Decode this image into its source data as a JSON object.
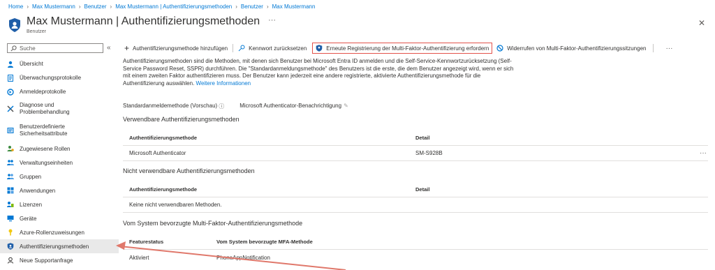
{
  "breadcrumb": [
    "Home",
    "Max Mustermann",
    "Benutzer",
    "Max Mustermann | Authentifizierungsmethoden",
    "Benutzer",
    "Max Mustermann"
  ],
  "header": {
    "title": "Max Mustermann | Authentifizierungsmethoden",
    "subtitle": "Benutzer",
    "more": "···",
    "close": "✕"
  },
  "sidebar": {
    "search_placeholder": "Suche",
    "collapse": "«",
    "items": [
      {
        "label": "Übersicht",
        "icon": "user-icon"
      },
      {
        "label": "Überwachungsprotokolle",
        "icon": "log-icon"
      },
      {
        "label": "Anmeldeprotokolle",
        "icon": "signin-icon"
      },
      {
        "label": "Diagnose und Problembehandlung",
        "icon": "wrench-icon"
      },
      {
        "label": "Benutzerdefinierte Sicherheitsattribute",
        "icon": "attribute-icon"
      },
      {
        "label": "Zugewiesene Rollen",
        "icon": "roles-icon"
      },
      {
        "label": "Verwaltungseinheiten",
        "icon": "admin-units-icon"
      },
      {
        "label": "Gruppen",
        "icon": "groups-icon"
      },
      {
        "label": "Anwendungen",
        "icon": "apps-icon"
      },
      {
        "label": "Lizenzen",
        "icon": "license-icon"
      },
      {
        "label": "Geräte",
        "icon": "device-icon"
      },
      {
        "label": "Azure-Rollenzuweisungen",
        "icon": "key-icon"
      },
      {
        "label": "Authentifizierungsmethoden",
        "icon": "shield-icon"
      },
      {
        "label": "Neue Supportanfrage",
        "icon": "support-icon"
      }
    ]
  },
  "toolbar": {
    "add": "Authentifizierungsmethode hinzufügen",
    "reset": "Kennwort zurücksetzen",
    "require_reregister": "Erneute Registrierung der Multi-Faktor-Authentifizierung erfordern",
    "revoke": "Widerrufen von Multi-Faktor-Authentifizierungssitzungen",
    "more": "···"
  },
  "content": {
    "description": "Authentifizierungsmethoden sind die Methoden, mit denen sich Benutzer bei Microsoft Entra ID anmelden und die Self-Service-Kennwortzurücksetzung (Self-Service Password Reset, SSPR) durchführen. Die \"Standardanmeldungsmethode\" des Benutzers ist die erste, die dem Benutzer angezeigt wird, wenn er sich mit einem zweiten Faktor authentifizieren muss. Der Benutzer kann jederzeit eine andere registrierte, aktivierte Authentifizierungsmethode für die Authentifizierung auswählen.",
    "more_info": "Weitere Informationen",
    "default_label": "Standardanmeldemethode (Vorschau)",
    "default_value": "Microsoft Authenticator-Benachrichtigung",
    "usable_title": "Verwendbare Authentifizierungsmethoden",
    "usable_headers": [
      "Authentifizierungsmethode",
      "Detail"
    ],
    "usable_rows": [
      [
        "Microsoft Authenticator",
        "SM-S928B"
      ]
    ],
    "row_more": "···",
    "unusable_title": "Nicht verwendbare Authentifizierungsmethoden",
    "unusable_headers": [
      "Authentifizierungsmethode",
      "Detail"
    ],
    "unusable_empty": "Keine nicht verwendbaren Methoden.",
    "mfa_title": "Vom System bevorzugte Multi-Faktor-Authentifizierungsmethode",
    "mfa_headers": [
      "Featurestatus",
      "Vom System bevorzugte MFA-Methode"
    ],
    "mfa_rows": [
      [
        "Aktiviert",
        "PhoneAppNotification"
      ]
    ]
  },
  "colors": {
    "link": "#0078d4",
    "highlight": "#e2524b",
    "arrow": "#e0786b"
  }
}
